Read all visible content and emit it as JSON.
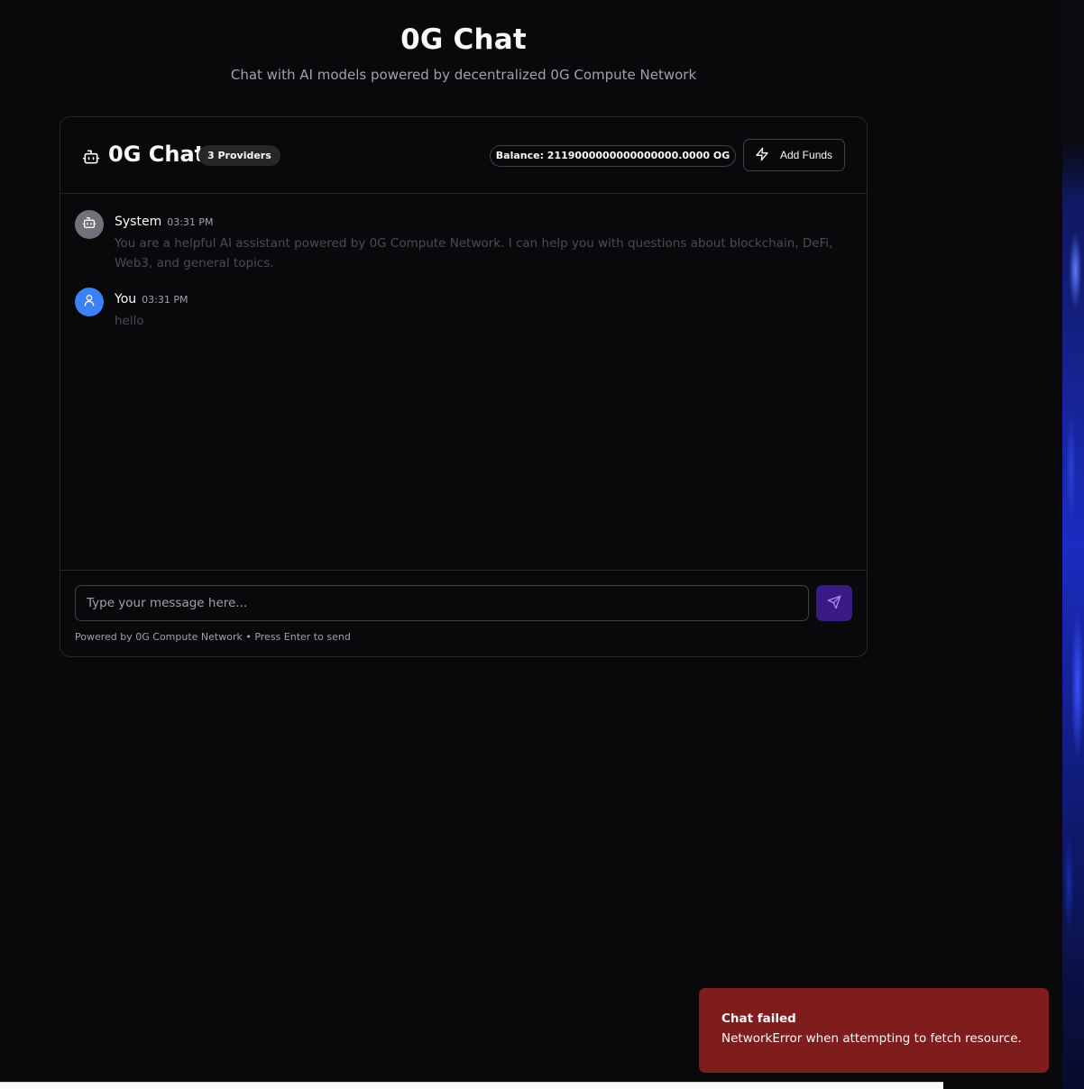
{
  "page": {
    "title": "0G Chat",
    "subtitle": "Chat with AI models powered by decentralized 0G Compute Network"
  },
  "chat": {
    "header": {
      "icon": "bot-icon",
      "title": "0G Chat",
      "providers_badge": "3 Providers",
      "balance": "Balance: 2119000000000000000.0000 OG",
      "add_funds_icon": "zap-icon",
      "add_funds_label": "Add Funds"
    },
    "messages": [
      {
        "author": "System",
        "time": "03:31 PM",
        "avatar_icon": "bot-icon",
        "avatar_color": "#71717a",
        "text": "You are a helpful AI assistant powered by 0G Compute Network. I can help you with questions about blockchain, DeFi, Web3, and general topics."
      },
      {
        "author": "You",
        "time": "03:31 PM",
        "avatar_icon": "user-icon",
        "avatar_color": "#3b82f6",
        "text": "hello"
      }
    ],
    "input": {
      "placeholder": "Type your message here...",
      "value": "",
      "send_icon": "send-icon"
    },
    "hint": "Powered by 0G Compute Network • Press Enter to send"
  },
  "toast": {
    "title": "Chat failed",
    "description": "NetworkError when attempting to fetch resource.",
    "color": "#7f1d1d"
  },
  "colors": {
    "background": "#09090b",
    "border": "#27272a",
    "accent": "#3b1a86"
  }
}
